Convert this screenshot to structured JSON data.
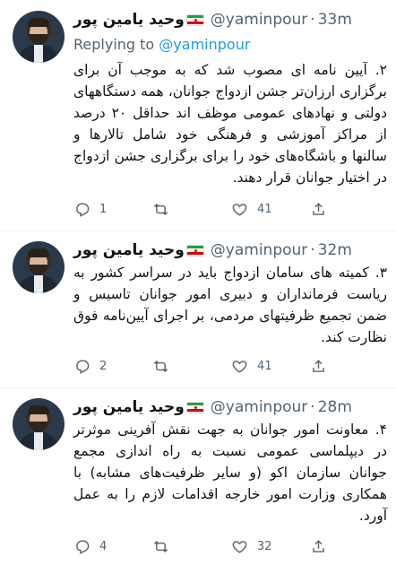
{
  "colors": {
    "link": "#1d9bf0",
    "muted": "#536471",
    "text": "#0f1419",
    "divider": "#eff3f4"
  },
  "tweets": [
    {
      "name": "وحید یامین پور",
      "handle": "@yaminpour",
      "dot": "·",
      "time": "33m",
      "replying_prefix": "Replying to",
      "replying_handle": "@yaminpour",
      "text": "۲. آیین نامه ای مصوب شد که به موجب آن برای برگزاری ارزان‌تر جشن ازدواج جوانان، همه دستگاههای دولتی و نهادهای عمومی موظف اند حداقل ۲۰ درصد از مراکز آموزشی و فرهنگی خود شامل تالارها و سالنها و باشگاه‌های خود را برای برگزاری جشن ازدواج در اختیار جوانان قرار دهند.",
      "replies": "1",
      "retweets": "",
      "likes": "41"
    },
    {
      "name": "وحید یامین پور",
      "handle": "@yaminpour",
      "dot": "·",
      "time": "32m",
      "text": "۳. کمیته های سامان ازدواج باید در سراسر کشور به ریاست فرمانداران و دبیری امور جوانان تاسیس و ضمن تجمیع ظرفیتهای مردمی، بر اجرای آیین‌نامه فوق نظارت کند.",
      "replies": "2",
      "retweets": "",
      "likes": "41"
    },
    {
      "name": "وحید یامین پور",
      "handle": "@yaminpour",
      "dot": "·",
      "time": "28m",
      "text": "۴. معاونت امور جوانان به جهت نقش آفرینی موثرتر در دیپلماسی عمومی نسبت به راه اندازی مجمع جوانان سازمان اکو (و سایر ظرفیت‌های مشابه) با همکاری وزارت امور خارجه اقدامات لازم را به عمل آورد.",
      "replies": "4",
      "retweets": "",
      "likes": "32"
    }
  ]
}
